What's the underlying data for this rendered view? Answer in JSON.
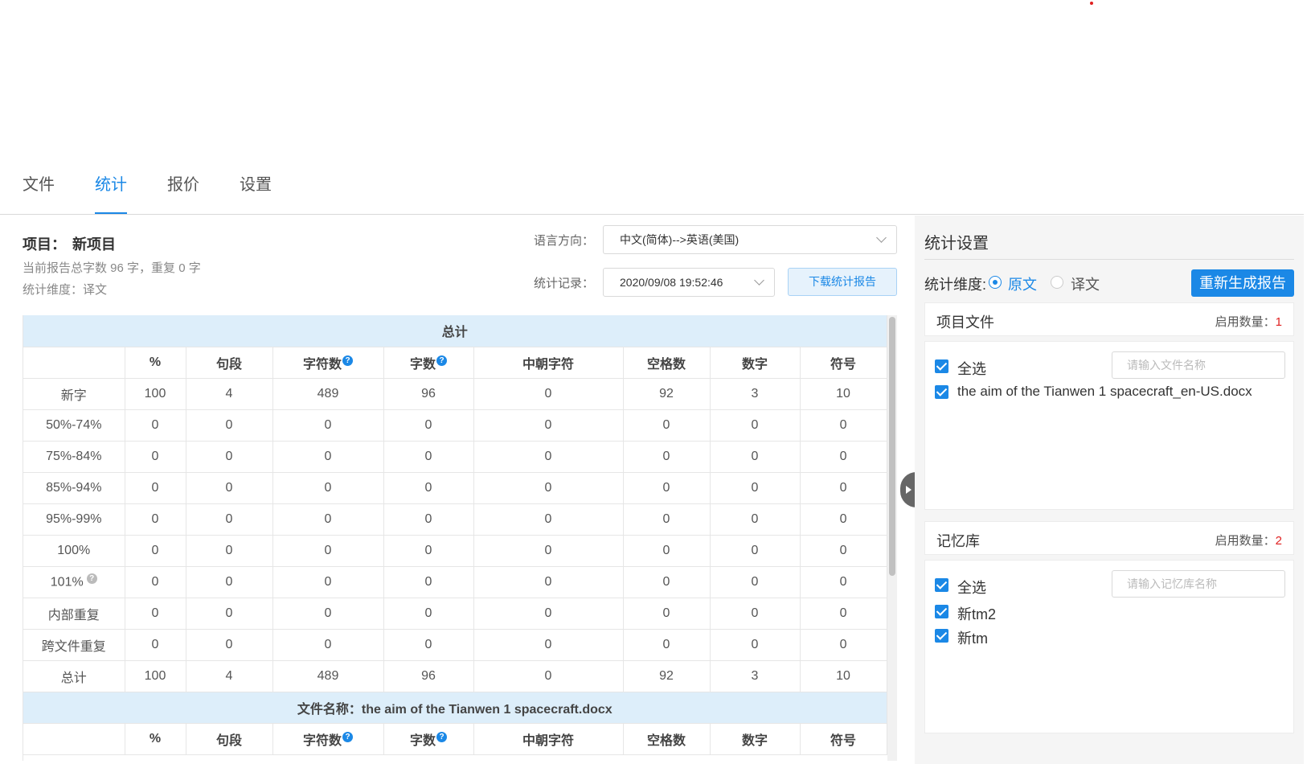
{
  "tabs": [
    {
      "label": "文件",
      "active": false
    },
    {
      "label": "统计",
      "active": true
    },
    {
      "label": "报价",
      "active": false
    },
    {
      "label": "设置",
      "active": false
    }
  ],
  "project": {
    "label": "项目：",
    "name": "新项目",
    "summary": "当前报告总字数 96 字，重复 0 字",
    "dimension": "统计维度：译文"
  },
  "filters": {
    "lang_label": "语言方向：",
    "lang_value": "中文(简体)-->英语(美国)",
    "record_label": "统计记录：",
    "record_value": "2020/09/08 19:52:46",
    "download_btn": "下载统计报告"
  },
  "table": {
    "section_total": "总计",
    "columns": [
      "",
      "%",
      "句段",
      "字符数",
      "字数",
      "中朝字符",
      "空格数",
      "数字",
      "符号"
    ],
    "rows": [
      [
        "新字",
        "100",
        "4",
        "489",
        "96",
        "0",
        "92",
        "3",
        "10"
      ],
      [
        "50%-74%",
        "0",
        "0",
        "0",
        "0",
        "0",
        "0",
        "0",
        "0"
      ],
      [
        "75%-84%",
        "0",
        "0",
        "0",
        "0",
        "0",
        "0",
        "0",
        "0"
      ],
      [
        "85%-94%",
        "0",
        "0",
        "0",
        "0",
        "0",
        "0",
        "0",
        "0"
      ],
      [
        "95%-99%",
        "0",
        "0",
        "0",
        "0",
        "0",
        "0",
        "0",
        "0"
      ],
      [
        "100%",
        "0",
        "0",
        "0",
        "0",
        "0",
        "0",
        "0",
        "0"
      ],
      [
        "101%",
        "0",
        "0",
        "0",
        "0",
        "0",
        "0",
        "0",
        "0"
      ],
      [
        "内部重复",
        "0",
        "0",
        "0",
        "0",
        "0",
        "0",
        "0",
        "0"
      ],
      [
        "跨文件重复",
        "0",
        "0",
        "0",
        "0",
        "0",
        "0",
        "0",
        "0"
      ],
      [
        "总计",
        "100",
        "4",
        "489",
        "96",
        "0",
        "92",
        "3",
        "10"
      ]
    ],
    "section_file": "文件名称：the aim of the Tianwen 1 spacecraft.docx",
    "help_glyph": "?"
  },
  "settings": {
    "title": "统计设置",
    "dim_label": "统计维度:",
    "radio_source": "原文",
    "radio_target": "译文",
    "regen_btn": "重新生成报告",
    "files_title": "项目文件",
    "files_count_label": "启用数量：",
    "files_count": "1",
    "files_select_all": "全选",
    "files_search_placeholder": "请输入文件名称",
    "files": [
      "the aim of the Tianwen 1 spacecraft_en-US.docx"
    ],
    "tm_title": "记忆库",
    "tm_count_label": "启用数量：",
    "tm_count": "2",
    "tm_select_all": "全选",
    "tm_search_placeholder": "请输入记忆库名称",
    "tms": [
      "新tm2",
      "新tm"
    ]
  },
  "colors": {
    "accent": "#1b88e6",
    "section_bg": "#ddeefa",
    "count_red": "#e02020"
  }
}
